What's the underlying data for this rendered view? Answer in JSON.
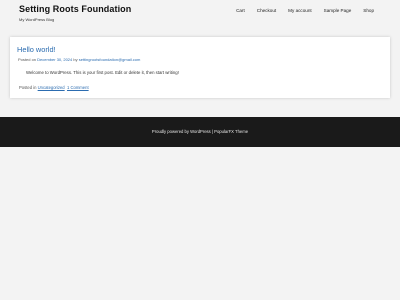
{
  "site": {
    "title": "Setting Roots Foundation",
    "tagline": "My WordPress Blog"
  },
  "nav": {
    "items": [
      {
        "label": "Cart"
      },
      {
        "label": "Checkout"
      },
      {
        "label": "My account"
      },
      {
        "label": "Sample Page"
      },
      {
        "label": "Shop"
      }
    ]
  },
  "post": {
    "title": "Hello world!",
    "meta_prefix": "Posted on ",
    "date": "December 30, 2024",
    "meta_by": " by ",
    "author": "settingrootsfoundation@gmail.com",
    "content": "Welcome to WordPress. This is your first post. Edit or delete it, then start writing!",
    "footer_prefix": "Posted in ",
    "category": "Uncategorized",
    "comments": "1 Comment"
  },
  "footer": {
    "credit_prefix": "Proudly powered by ",
    "wordpress": "WordPress",
    "separator": " | ",
    "theme": "PopularFX Theme"
  }
}
